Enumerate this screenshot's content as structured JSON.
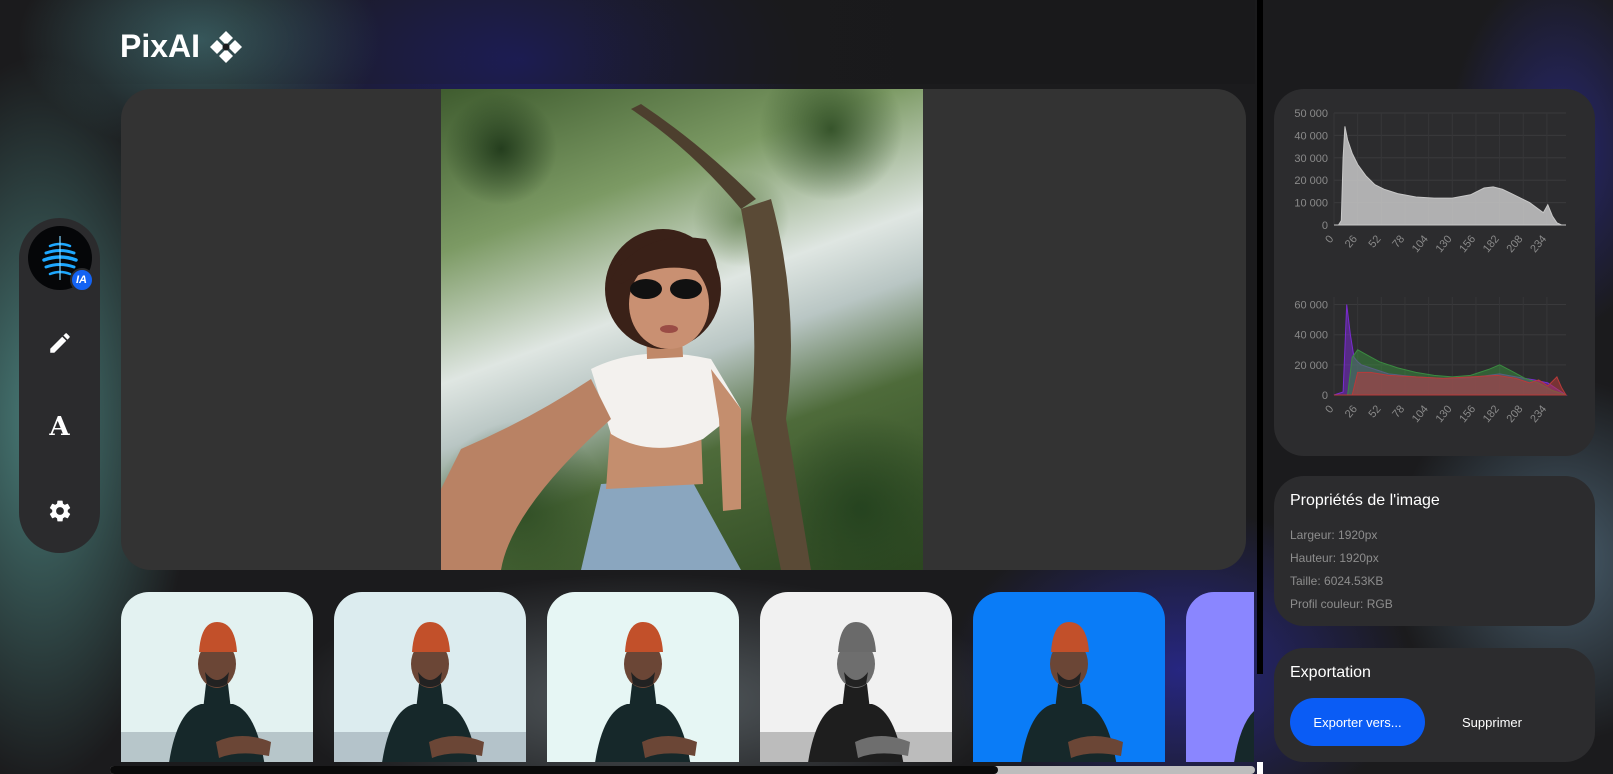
{
  "app": {
    "name": "PixAI"
  },
  "toolbar": {
    "ai_badge": "IA",
    "tools": [
      {
        "name": "edit-tool-button",
        "icon": "pencil-icon"
      },
      {
        "name": "text-tool-button",
        "icon": "font-icon",
        "glyph": "A"
      },
      {
        "name": "settings-tool-button",
        "icon": "gear-icon"
      }
    ]
  },
  "thumbnails": [
    {
      "bg": "#e3f2f1",
      "variant": "original"
    },
    {
      "bg": "#dcecef",
      "variant": "blur"
    },
    {
      "bg": "#e6f6f4",
      "variant": "soft"
    },
    {
      "bg": "#f1f1f1",
      "variant": "grayscale"
    },
    {
      "bg": "#0a7cf7",
      "variant": "blue-background"
    },
    {
      "bg": "#8a86ff",
      "variant": "purple-background"
    }
  ],
  "chart_data": [
    {
      "type": "area",
      "title": "",
      "x_ticks": [
        "0",
        "26",
        "52",
        "78",
        "104",
        "130",
        "156",
        "182",
        "208",
        "234"
      ],
      "y_ticks": [
        "0",
        "10 000",
        "20 000",
        "30 000",
        "40 000",
        "50 000"
      ],
      "ylim": [
        0,
        50000
      ],
      "xlim": [
        0,
        255
      ],
      "series": [
        {
          "color": "#c8c8c8",
          "x": [
            0,
            5,
            8,
            10,
            12,
            15,
            20,
            26,
            35,
            45,
            55,
            70,
            90,
            110,
            130,
            150,
            165,
            175,
            185,
            195,
            205,
            215,
            225,
            230,
            235,
            240,
            245,
            250,
            255
          ],
          "values": [
            0,
            0,
            2000,
            30000,
            44000,
            38000,
            32000,
            27000,
            22000,
            18000,
            16000,
            14000,
            12500,
            12000,
            12000,
            13500,
            16500,
            17000,
            16000,
            14000,
            12000,
            10000,
            7000,
            5500,
            9000,
            4000,
            1000,
            0,
            0
          ]
        }
      ]
    },
    {
      "type": "area",
      "title": "",
      "x_ticks": [
        "0",
        "26",
        "52",
        "78",
        "104",
        "130",
        "156",
        "182",
        "208",
        "234"
      ],
      "y_ticks": [
        "0",
        "20 000",
        "40 000",
        "60 000"
      ],
      "ylim": [
        0,
        65000
      ],
      "xlim": [
        0,
        255
      ],
      "series": [
        {
          "color": "#7a2bd0",
          "x": [
            0,
            10,
            14,
            18,
            22,
            26,
            30,
            40,
            60,
            90,
            120,
            150,
            170,
            182,
            200,
            220,
            235,
            245,
            255
          ],
          "values": [
            0,
            2000,
            60000,
            40000,
            25000,
            22000,
            20000,
            18000,
            14000,
            12000,
            11000,
            11500,
            13000,
            14000,
            12000,
            10000,
            8000,
            4000,
            0
          ]
        },
        {
          "color": "#3a8a40",
          "x": [
            0,
            15,
            20,
            26,
            35,
            50,
            70,
            90,
            110,
            130,
            150,
            170,
            182,
            195,
            210,
            225,
            240,
            255
          ],
          "values": [
            0,
            0,
            25000,
            30000,
            27000,
            22000,
            18000,
            15000,
            13000,
            12000,
            13000,
            17000,
            20000,
            16000,
            11000,
            8000,
            3000,
            0
          ]
        },
        {
          "color": "#b83a3a",
          "x": [
            0,
            20,
            26,
            40,
            60,
            90,
            120,
            150,
            180,
            200,
            215,
            225,
            235,
            245,
            250,
            255
          ],
          "values": [
            0,
            0,
            15000,
            15000,
            13000,
            12000,
            11000,
            12000,
            13000,
            11000,
            8000,
            10000,
            6000,
            12000,
            5000,
            0
          ]
        }
      ]
    }
  ],
  "properties": {
    "title": "Propriétés de l'image",
    "width": "Largeur: 1920px",
    "height": "Hauteur: 1920px",
    "size": "Taille: 6024.53KB",
    "color_profile": "Profil couleur: RGB"
  },
  "export": {
    "title": "Exportation",
    "export_label": "Exporter vers...",
    "delete_label": "Supprimer"
  }
}
